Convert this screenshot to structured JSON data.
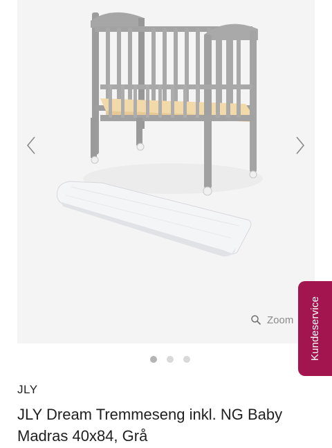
{
  "gallery": {
    "image_alt": "JLY Dream Tremmeseng med madras",
    "prev_icon": "chevron-left-icon",
    "next_icon": "chevron-right-icon",
    "zoom": {
      "label": "Zoom",
      "icon": "magnifier-icon"
    },
    "dots": {
      "count": 3,
      "active_index": 0
    }
  },
  "customer_service": {
    "label": "Kundeservice",
    "color": "#a3154f"
  },
  "product": {
    "brand": "JLY",
    "title": "JLY Dream Tremmeseng inkl. NG Baby Madras 40x84, Grå"
  }
}
